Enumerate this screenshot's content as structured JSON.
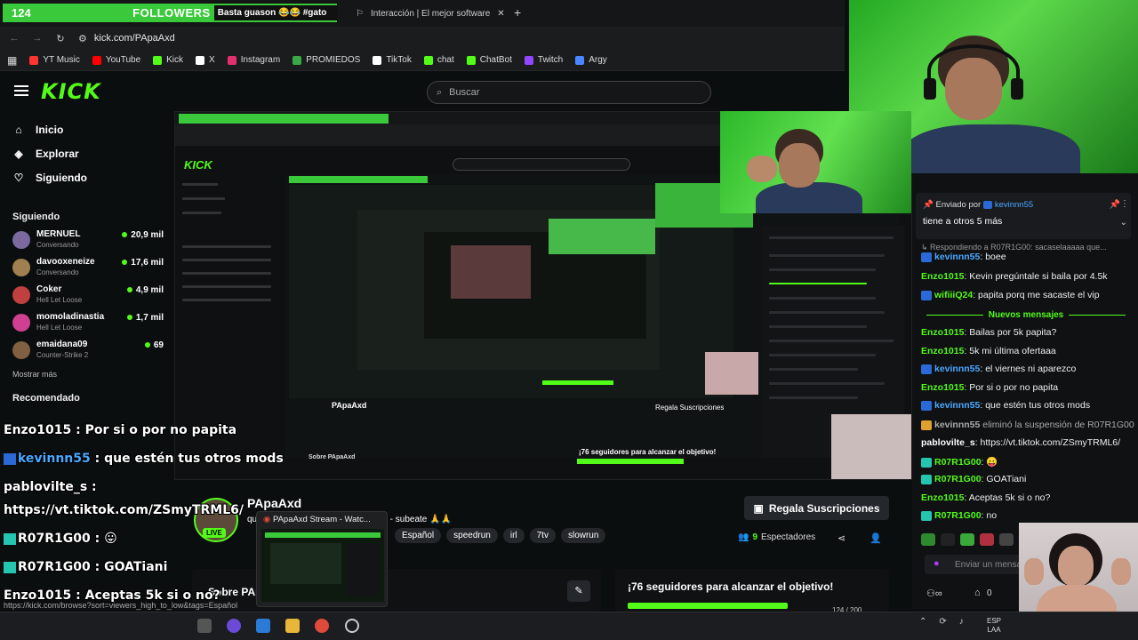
{
  "overlay": {
    "followers_count": "124",
    "followers_label": "FOLLOWERS",
    "goal_text": "Basta guason 😂😂 #gato",
    "goal_number": "200"
  },
  "browser": {
    "tab_title": "Interacción | El mejor software",
    "url": "kick.com/PApaAxd",
    "bookmarks": [
      {
        "label": "YT Music",
        "color": "#ff3333"
      },
      {
        "label": "YouTube",
        "color": "#ff0000"
      },
      {
        "label": "Kick",
        "color": "#53fc18"
      },
      {
        "label": "X",
        "color": "#ffffff"
      },
      {
        "label": "Instagram",
        "color": "#e1306c"
      },
      {
        "label": "PROMIEDOS",
        "color": "#3aa845"
      },
      {
        "label": "TikTok",
        "color": "#ffffff"
      },
      {
        "label": "chat",
        "color": "#53fc18"
      },
      {
        "label": "ChatBot",
        "color": "#53fc18"
      },
      {
        "label": "Twitch",
        "color": "#9146ff"
      },
      {
        "label": "Argy",
        "color": "#4a86ff"
      }
    ]
  },
  "kick": {
    "logo": "KICK",
    "search_placeholder": "Buscar",
    "nav": [
      {
        "label": "Inicio",
        "icon": "home-icon"
      },
      {
        "label": "Explorar",
        "icon": "compass-icon"
      },
      {
        "label": "Siguiendo",
        "icon": "heart-icon"
      }
    ],
    "following_title": "Siguiendo",
    "following": [
      {
        "name": "MERNUEL",
        "sub": "Conversando",
        "viewers": "20,9 mil",
        "color": "#7a6aa0"
      },
      {
        "name": "davooxeneize",
        "sub": "Conversando",
        "viewers": "17,6 mil",
        "color": "#a08050"
      },
      {
        "name": "Coker",
        "sub": "Hell Let Loose",
        "viewers": "4,9 mil",
        "color": "#c04040"
      },
      {
        "name": "momoladinastia",
        "sub": "Hell Let Loose",
        "viewers": "1,7 mil",
        "color": "#d04090"
      },
      {
        "name": "emaidana09",
        "sub": "Counter-Strike 2",
        "viewers": "69",
        "color": "#806040"
      }
    ],
    "show_more": "Mostrar más",
    "recommended_title": "Recomendado"
  },
  "stream": {
    "streamer": "PApaAxd",
    "live": "LIVE",
    "title": "que paso?? - speedrun - cualquiera - subeate 🙏🙏",
    "tags": [
      "Español",
      "speedrun",
      "irl",
      "7tv",
      "slowrun"
    ],
    "subscribe": "Regala Suscripciones",
    "viewers": "9",
    "viewers_label": "Espectadores",
    "about": "Sobre PApaAxd",
    "goal_title": "¡76 seguidores para alcanzar el objetivo!",
    "goal_count": "124 / 200",
    "goal_progress": 0.62,
    "thumbnail_title": "PApaAxd Stream - Watc..."
  },
  "chat": {
    "pinned_by": "Enviado por",
    "pinned_user": "kevinnn55",
    "pinned_text": "tiene a otros 5 más",
    "reply_note": "Respondiendo a R07R1G00: sacaselaaaaa que...",
    "new_messages": "Nuevos mensajes",
    "input_placeholder": "Enviar un mensaje",
    "points": "0",
    "messages": [
      {
        "user": "kevinnn55",
        "text": ": boee",
        "color": "#4aa8ff",
        "badge": "kick"
      },
      {
        "user": "Enzo1015",
        "text": ": Kevin pregúntale si baila por 4.5k",
        "color": "#53fc18",
        "badge": "none"
      },
      {
        "user": "wifiiiQ24",
        "text": ": papita porq me sacaste el vip",
        "color": "#53fc18",
        "badge": "kick"
      },
      {
        "user": "Enzo1015",
        "text": ": Bailas por 5k papita?",
        "color": "#53fc18",
        "badge": "none"
      },
      {
        "user": "Enzo1015",
        "text": ": 5k mi última ofertaaa",
        "color": "#53fc18",
        "badge": "none"
      },
      {
        "user": "kevinnn55",
        "text": ": el viernes ni aparezco",
        "color": "#4aa8ff",
        "badge": "kick"
      },
      {
        "user": "Enzo1015",
        "text": ": Por si o por no papita",
        "color": "#53fc18",
        "badge": "none"
      },
      {
        "user": "kevinnn55",
        "text": ": que estén tus otros mods",
        "color": "#4aa8ff",
        "badge": "kick"
      },
      {
        "user": "kevinnn55",
        "text": " eliminó la suspensión de R07R1G00",
        "color": "#aaaaaa",
        "badge": "mod"
      },
      {
        "user": "pablovilte_s",
        "text": ": https://vt.tiktok.com/ZSmyTRML6/",
        "color": "#ffffff",
        "badge": "none"
      },
      {
        "user": "R07R1G00",
        "text": ": 😛",
        "color": "#53fc18",
        "badge": "gift"
      },
      {
        "user": "R07R1G00",
        "text": ": GOATiani",
        "color": "#53fc18",
        "badge": "gift"
      },
      {
        "user": "Enzo1015",
        "text": ": Aceptas 5k si o no?",
        "color": "#53fc18",
        "badge": "none"
      },
      {
        "user": "R07R1G00",
        "text": ": no",
        "color": "#53fc18",
        "badge": "gift"
      }
    ]
  },
  "overlay_chat": [
    {
      "user": "Enzo1015",
      "text": " : Por si o por no papita",
      "badge": "none"
    },
    {
      "user": "kevinnn55",
      "text": " : que estén tus otros mods",
      "badge": "kick"
    },
    {
      "user": "pablovilte_s",
      "text": " :",
      "badge": "none"
    },
    {
      "user": "",
      "text": "https://vt.tiktok.com/ZSmyTRML6/",
      "badge": "none"
    },
    {
      "user": "R07R1G00",
      "text": " : 😛",
      "badge": "gift"
    },
    {
      "user": "R07R1G00",
      "text": " : GOATiani",
      "badge": "gift"
    },
    {
      "user": "Enzo1015",
      "text": " : Aceptas 5k si o no?",
      "badge": "none"
    },
    {
      "user": "R07R1G00",
      "text": " : no",
      "badge": "gift"
    }
  ],
  "status_url": "https://kick.com/browse?sort=viewers_high_to_low&tags=Español",
  "tray": {
    "lang": "ESP",
    "region": "LAA"
  }
}
